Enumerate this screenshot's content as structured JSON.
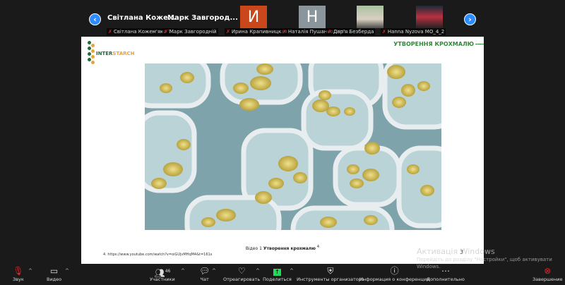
{
  "participants_strip": {
    "name_tiles": [
      "Світлана Коже...",
      "Марк Завгород..."
    ],
    "avatars": [
      {
        "initial": "И",
        "color": "#c9471b"
      },
      {
        "initial": "Н",
        "color": "#8a969c"
      }
    ],
    "labels": [
      "Світлана Кожем'яко Т...",
      "Марк Завгородній",
      "Ирина Крапивницкая",
      "Наталія Пушанко, ННІ...",
      "Дар'я Безберда",
      "Hanna Nyzova MO_4_2"
    ]
  },
  "slide": {
    "logo_inter": "INTER",
    "logo_starch": "STARCH",
    "title": "УТВОРЕННЯ КРОХМАЛЮ",
    "caption_prefix": "Відео 1",
    "caption_bold": "Утворення крохмалю",
    "caption_sup": "4",
    "footnote": "4. https://www.youtube.com/watch?v=oiGUjvMHqM4&t=161s",
    "page_number": "3"
  },
  "watermark": {
    "title": "Активація Windows",
    "line1": "Перейдіть до розділу \"Настройки\", щоб активувати",
    "line2": "Windows."
  },
  "toolbar": {
    "audio": "Звук",
    "video": "Видео",
    "participants": "Участники",
    "participants_count": "46",
    "chat": "Чат",
    "react": "Отреагировать",
    "share": "Поделиться",
    "host_tools": "Инструменты организатора",
    "info": "Информация о конференции",
    "more": "Дополнительно",
    "end": "Завершение"
  },
  "colors": {
    "accent": "#2d8cff",
    "logo_green": "#1f6b35",
    "logo_orange": "#e8a33a",
    "title_green": "#2f8a3a",
    "share_green": "#23d959",
    "end_red": "#e02828"
  }
}
